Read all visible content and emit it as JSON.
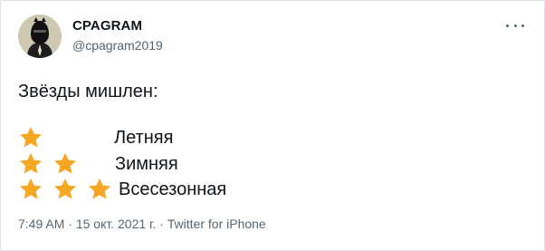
{
  "tweet": {
    "display_name": "CPAGRAM",
    "handle": "@cpagram2019",
    "more_icon": "more-horizontal-icon",
    "text": "Звёзды мишлен:",
    "ratings": [
      {
        "stars": 1,
        "label": "Летняя"
      },
      {
        "stars": 2,
        "label": "Зимняя"
      },
      {
        "stars": 3,
        "label": "Всесезонная"
      }
    ],
    "star_icon": "star-icon",
    "star_color": "#f5a623",
    "time": "7:49 AM",
    "date": "15 окт. 2021 г.",
    "separator": "·",
    "source": "Twitter for iPhone"
  }
}
